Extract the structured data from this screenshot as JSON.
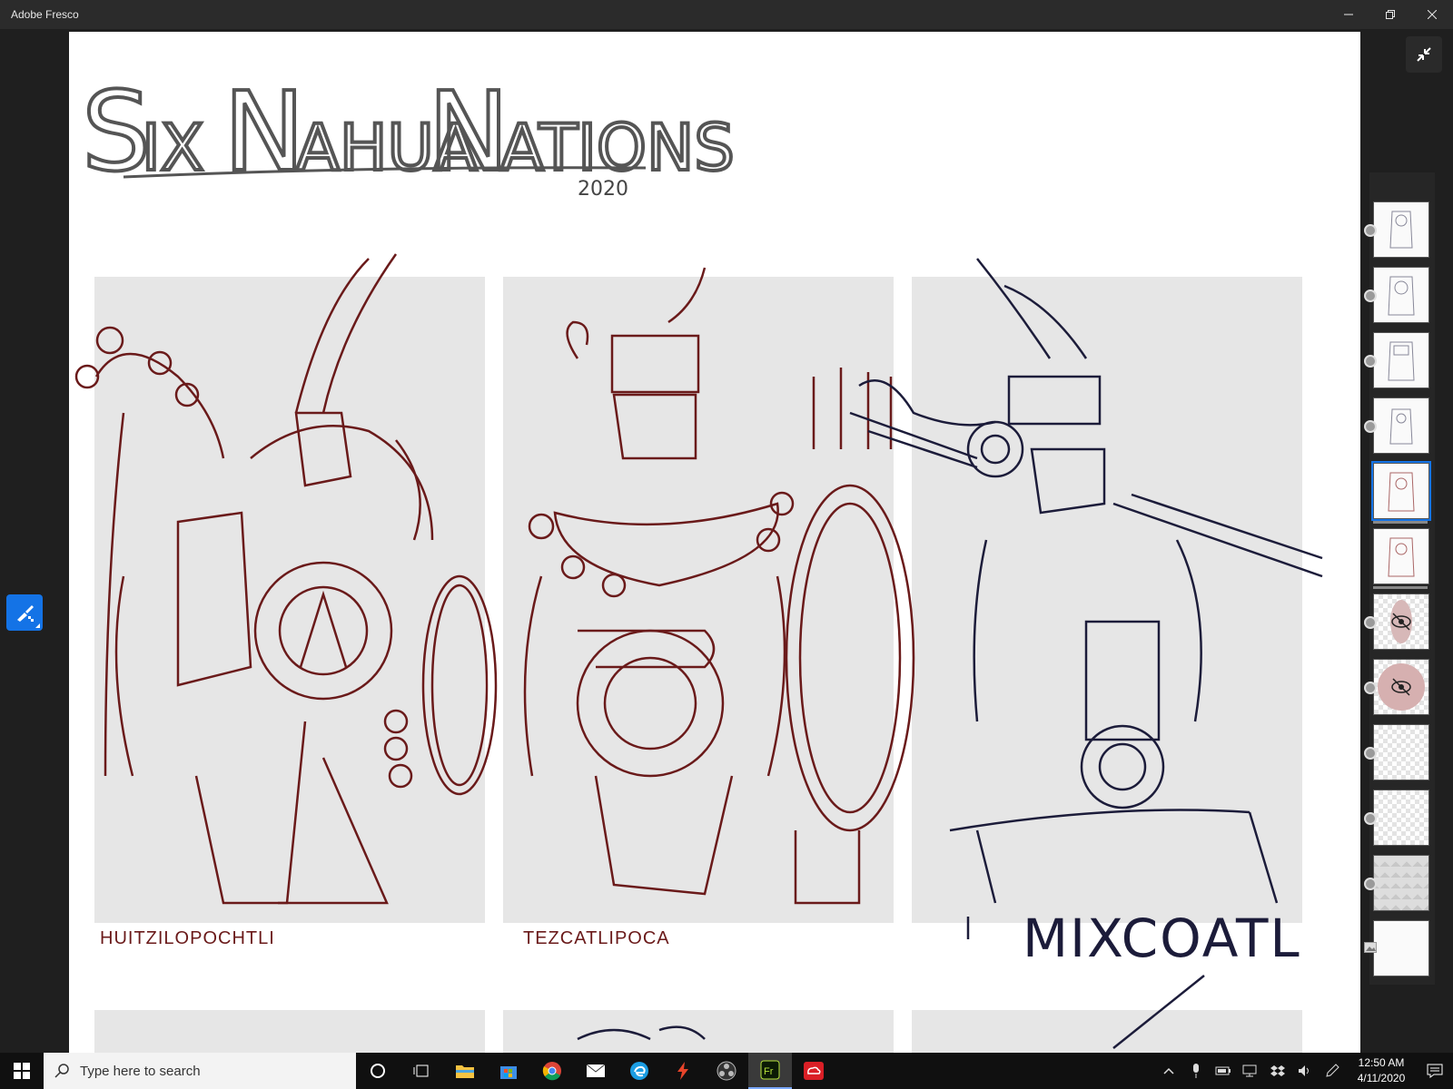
{
  "window": {
    "title": "Adobe Fresco",
    "controls": [
      "minimize",
      "restore",
      "close"
    ]
  },
  "canvas": {
    "title_art": "SIX NAHUA NATIONS",
    "year": "2020",
    "panels": [
      {
        "caption": "HUITZILOPOCHTLI",
        "ink_color": "#6a1a1a"
      },
      {
        "caption": "TEZCATLIPOCA",
        "ink_color": "#6a1a1a"
      },
      {
        "caption": "MIXCOATL",
        "ink_color": "#1c1c3a"
      }
    ]
  },
  "tools": {
    "active_tool": "pixel-brush-icon",
    "exit_fullscreen": "collapse-icon"
  },
  "layers": [
    {
      "name": "layer-1",
      "hidden": false
    },
    {
      "name": "layer-2",
      "hidden": false
    },
    {
      "name": "layer-3",
      "hidden": false
    },
    {
      "name": "layer-4",
      "hidden": false
    },
    {
      "name": "layer-5",
      "hidden": false,
      "active": true
    },
    {
      "name": "layer-6",
      "hidden": false
    },
    {
      "name": "layer-7",
      "hidden": true
    },
    {
      "name": "layer-8",
      "hidden": true
    },
    {
      "name": "layer-9",
      "hidden": false
    },
    {
      "name": "layer-10",
      "hidden": false
    },
    {
      "name": "layer-11",
      "hidden": false
    },
    {
      "name": "layer-12",
      "hidden": false
    }
  ],
  "taskbar": {
    "search_placeholder": "Type here to search",
    "apps": [
      "cortana",
      "task-view",
      "file-explorer",
      "store",
      "chrome",
      "mail",
      "edge",
      "app-red",
      "obs",
      "fresco",
      "creative-cloud"
    ],
    "clock_time": "12:50 AM",
    "clock_date": "4/11/2020"
  },
  "colors": {
    "accent": "#1473e6",
    "panel_bg": "#e6e6e6",
    "taskbar": "#101010"
  }
}
